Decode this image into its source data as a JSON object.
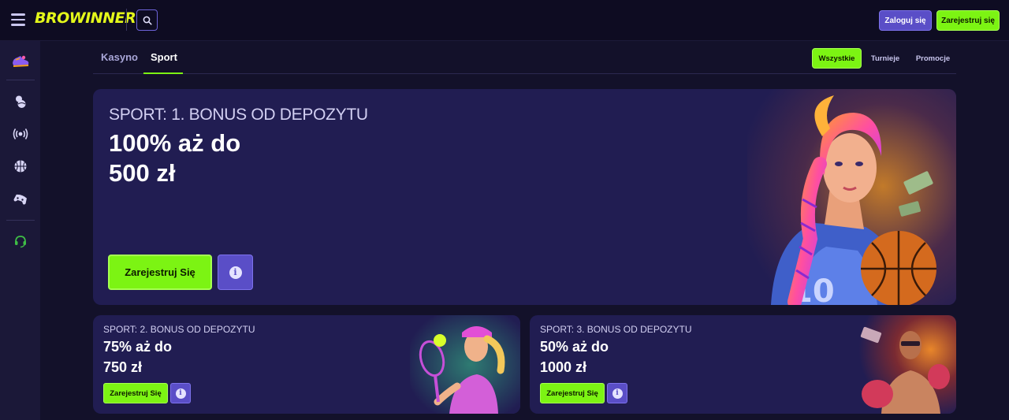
{
  "header": {
    "logo": "BROWINNER",
    "login_label": "Zaloguj się",
    "register_label": "Zarejestruj się"
  },
  "sidebar": {
    "items": [
      {
        "icon": "sneakers-icon"
      },
      {
        "icon": "sports-balls-icon"
      },
      {
        "icon": "live-broadcast-icon"
      },
      {
        "icon": "basketball-icon"
      },
      {
        "icon": "gamepad-icon"
      },
      {
        "icon": "support-headset-icon"
      }
    ]
  },
  "tabs": [
    {
      "label": "Kasyno",
      "active": false
    },
    {
      "label": "Sport",
      "active": true
    }
  ],
  "filters": [
    {
      "label": "Wszystkie",
      "active": true
    },
    {
      "label": "Turnieje",
      "active": false
    },
    {
      "label": "Promocje",
      "active": false
    }
  ],
  "promos": {
    "main": {
      "subtitle": "SPORT: 1. BONUS OD DEPOZYTU",
      "title_line1": "100% aż do",
      "title_line2": "500 zł",
      "cta": "Zarejestruj Się",
      "info": "i"
    },
    "second": {
      "subtitle": "SPORT: 2. BONUS OD DEPOZYTU",
      "title_line1": "75% aż do",
      "title_line2": "750 zł",
      "cta": "Zarejestruj Się",
      "info": "i"
    },
    "third": {
      "subtitle": "SPORT: 3. BONUS OD DEPOZYTU",
      "title_line1": "50% aż do",
      "title_line2": "1000 zł",
      "cta": "Zarejestruj Się",
      "info": "i"
    }
  },
  "colors": {
    "accent_green": "#7cf413",
    "accent_purple": "#5a4ec7",
    "card_bg": "#211d52",
    "page_bg": "#13112a"
  }
}
